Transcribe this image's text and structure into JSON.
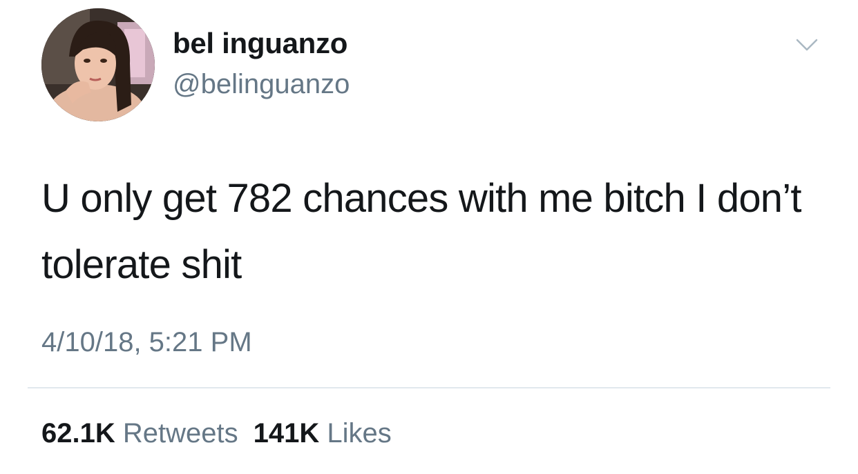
{
  "tweet": {
    "author": {
      "display_name": "bel inguanzo",
      "handle": "@belinguanzo"
    },
    "text": "U only get 782 chances with me bitch I don’t tolerate shit",
    "timestamp": "4/10/18, 5:21 PM",
    "stats": {
      "retweets_count": "62.1K",
      "retweets_label": "Retweets",
      "likes_count": "141K",
      "likes_label": "Likes"
    },
    "menu_icon": "chevron-down-icon"
  },
  "colors": {
    "text": "#14171a",
    "secondary": "#657786",
    "divider": "#e1e8ed",
    "background": "#ffffff"
  }
}
